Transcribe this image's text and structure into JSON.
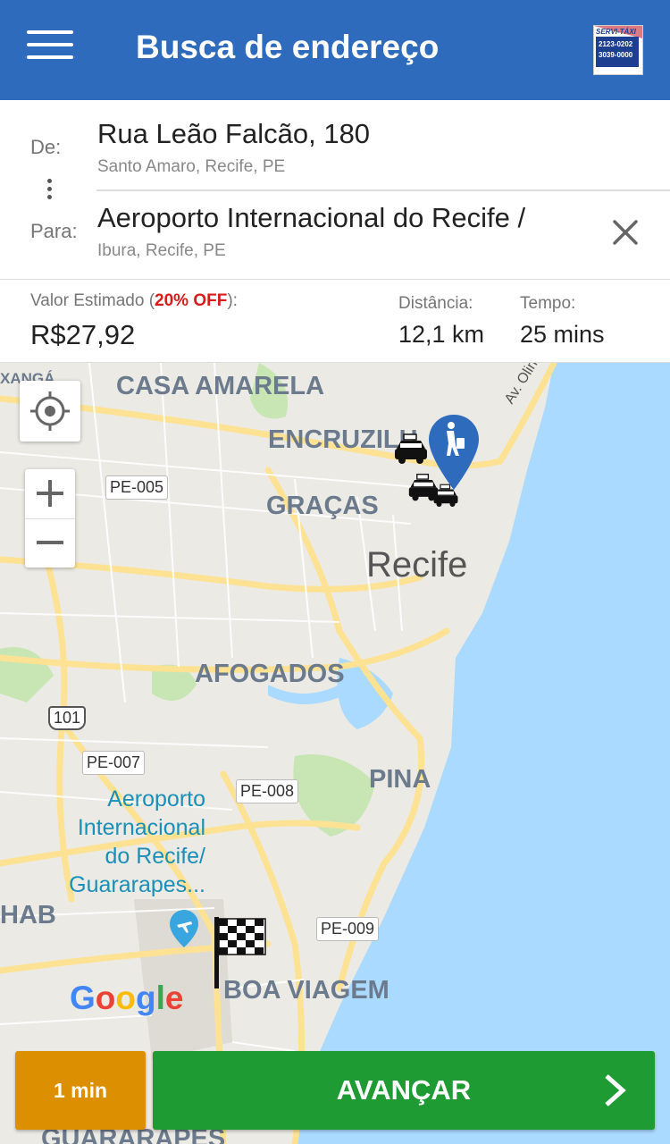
{
  "header": {
    "title": "Busca de endereço",
    "menu_icon": "hamburger-menu-icon",
    "logo_text_top": "SERVI-TÁXI",
    "logo_lines": [
      "2123-0202",
      "3039-0000"
    ]
  },
  "route": {
    "from_label": "De:",
    "to_label": "Para:",
    "from_main": "Rua Leão Falcão, 180",
    "from_sub": "Santo Amaro, Recife, PE",
    "to_main": "Aeroporto Internacional do Recife /",
    "to_sub": "Ibura, Recife, PE"
  },
  "estimate": {
    "label_prefix": "Valor Estimado (",
    "discount": "20% OFF",
    "label_suffix": "):",
    "value": "R$27,92",
    "distance_label": "Distância:",
    "distance_value": "12,1 km",
    "time_label": "Tempo:",
    "time_value": "25 mins"
  },
  "map": {
    "labels": {
      "casa_amarela": "CASA AMARELA",
      "encruzilhada": "ENCRUZILH",
      "gracas": "GRAÇAS",
      "recife": "Recife",
      "afogados": "AFOGADOS",
      "pina": "PINA",
      "boa_viagem": "BOA VIAGEM",
      "hab": "HAB",
      "guararapes": "GUARARAPES",
      "xanga": "XANGÁ",
      "av_olinda": "Av. Olinda",
      "airport": [
        "Aeroporto",
        "Internacional",
        "do Recife/",
        "Guararapes..."
      ],
      "google": "Google"
    },
    "shields": {
      "pe005": "PE-005",
      "br101": "101",
      "pe007": "PE-007",
      "pe008": "PE-008",
      "pe009": "PE-009"
    },
    "colors": {
      "water": "#aadaff",
      "land": "#eceae4",
      "park": "#c8e6b4",
      "road": "#fde293",
      "accent": "#2f6bbd"
    }
  },
  "actions": {
    "eta": "1 min",
    "next": "AVANÇAR"
  }
}
